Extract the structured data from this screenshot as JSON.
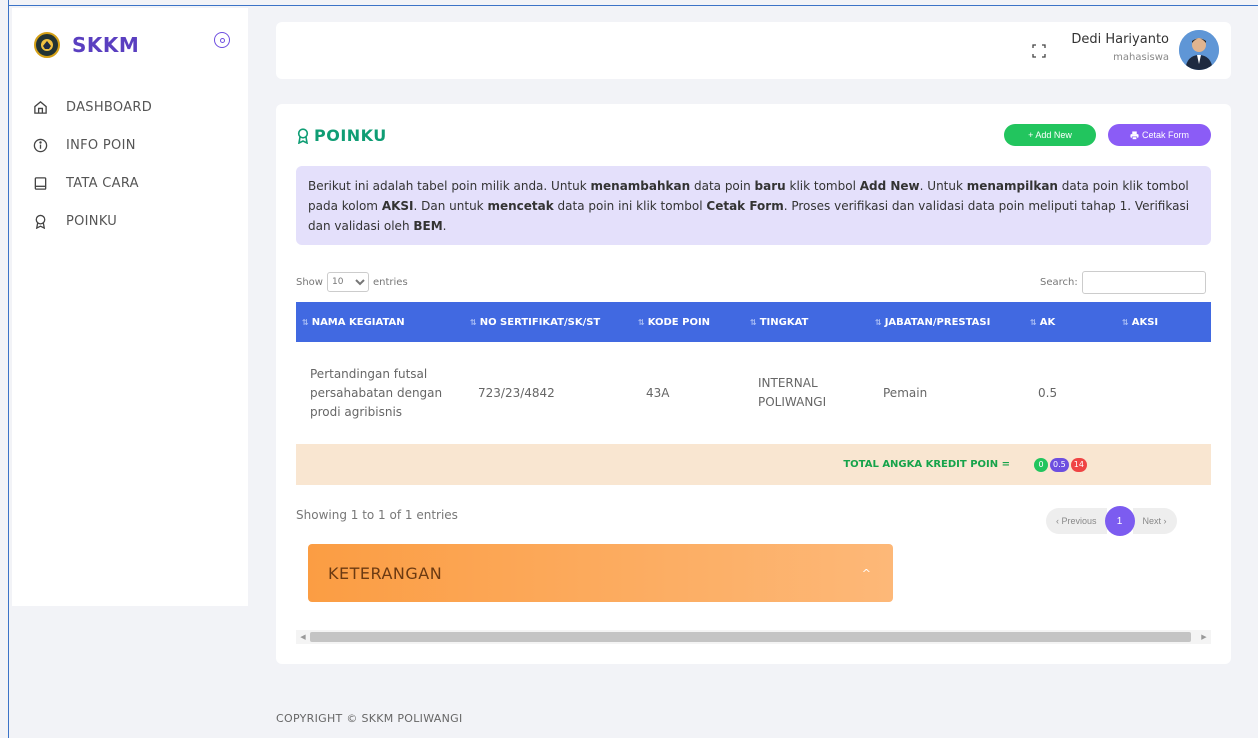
{
  "brand": {
    "name": "SKKM",
    "logo_icon": "university-seal-icon"
  },
  "sidebar": {
    "items": [
      {
        "label": "DASHBOARD",
        "icon": "home-icon"
      },
      {
        "label": "INFO POIN",
        "icon": "info-icon"
      },
      {
        "label": "TATA CARA",
        "icon": "book-icon"
      },
      {
        "label": "POINKU",
        "icon": "award-icon"
      }
    ]
  },
  "header": {
    "user_name": "Dedi Hariyanto",
    "user_role": "mahasiswa"
  },
  "card": {
    "title": "POINKU",
    "add_label": "+ Add New",
    "print_label": "Cetak Form",
    "info": {
      "t1": "Berikut ini adalah tabel poin milik anda. Untuk ",
      "b1": "menambahkan",
      "t2": " data poin ",
      "b2": "baru",
      "t3": " klik tombol ",
      "b3": "Add New",
      "t4": ". Untuk ",
      "b4": "menampilkan",
      "t5": " data poin klik tombol pada kolom ",
      "b5": "AKSI",
      "t6": ". Dan untuk ",
      "b6": "mencetak",
      "t7": " data poin ini klik tombol ",
      "b7": "Cetak Form",
      "t8": ". Proses verifikasi dan validasi data poin meliputi tahap 1. Verifikasi dan validasi oleh ",
      "b8": "BEM",
      "t9": "."
    }
  },
  "table": {
    "show_label": "Show",
    "entries_value": "10",
    "entries_label": "entries",
    "search_label": "Search:",
    "search_value": "",
    "headers": [
      "NAMA KEGIATAN",
      "NO SERTIFIKAT/SK/ST",
      "KODE POIN",
      "TINGKAT",
      "JABATAN/PRESTASI",
      "AK",
      "AKSI"
    ],
    "rows": [
      {
        "nama_kegiatan": "Pertandingan futsal persahabatan dengan prodi agribisnis",
        "no_sertifikat": "723/23/4842",
        "kode_poin": "43A",
        "tingkat": "INTERNAL POLIWANGI",
        "jabatan": "Pemain",
        "ak": "0.5",
        "aksi": ""
      }
    ],
    "total_label": "TOTAL ANGKA KREDIT POIN =",
    "badges": [
      {
        "value": "0",
        "color": "#22c55e"
      },
      {
        "value": "0.5",
        "color": "#6d4fe0"
      },
      {
        "value": "14",
        "color": "#ef4444"
      }
    ],
    "showing_text": "Showing 1 to 1 of 1 entries",
    "pager": {
      "prev": "‹ Previous",
      "current": "1",
      "next": "Next ›"
    }
  },
  "accordion": {
    "title": "KETERANGAN"
  },
  "footer": {
    "copyright": "COPYRIGHT © SKKM POLIWANGI"
  }
}
